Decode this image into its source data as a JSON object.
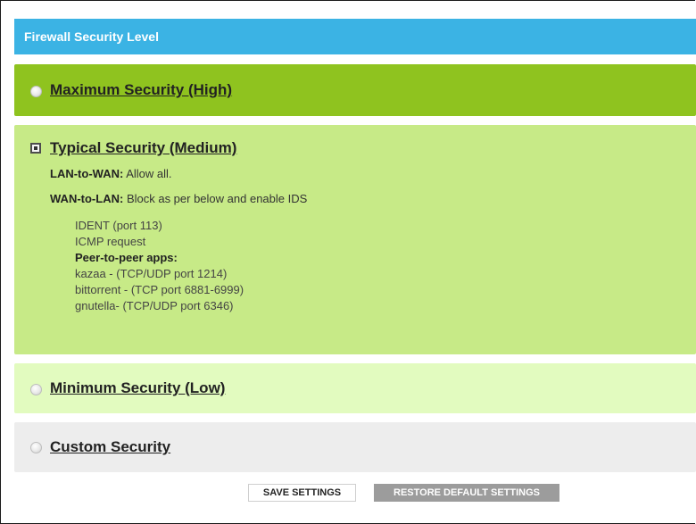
{
  "header": {
    "title": "Firewall Security Level"
  },
  "options": {
    "high": {
      "label": "Maximum Security (High)",
      "selected": false
    },
    "medium": {
      "label": "Typical Security (Medium)",
      "selected": true,
      "lan_to_wan_label": "LAN-to-WAN:",
      "lan_to_wan_value": "Allow all.",
      "wan_to_lan_label": "WAN-to-LAN:",
      "wan_to_lan_value": "Block as per below and enable IDS",
      "blocked": [
        "IDENT (port 113)",
        "ICMP request",
        "Peer-to-peer apps:",
        "kazaa - (TCP/UDP port 1214)",
        "bittorrent - (TCP port 6881-6999)",
        "gnutella- (TCP/UDP port 6346)"
      ]
    },
    "low": {
      "label": "Minimum Security (Low)",
      "selected": false
    },
    "custom": {
      "label": "Custom Security",
      "selected": false
    }
  },
  "buttons": {
    "save": "SAVE SETTINGS",
    "restore": "RESTORE DEFAULT SETTINGS"
  },
  "colors": {
    "header": "#3bb3e4",
    "high": "#8fc31f",
    "medium": "#c7ea87",
    "low": "#e2fbbf",
    "custom": "#ededed"
  }
}
